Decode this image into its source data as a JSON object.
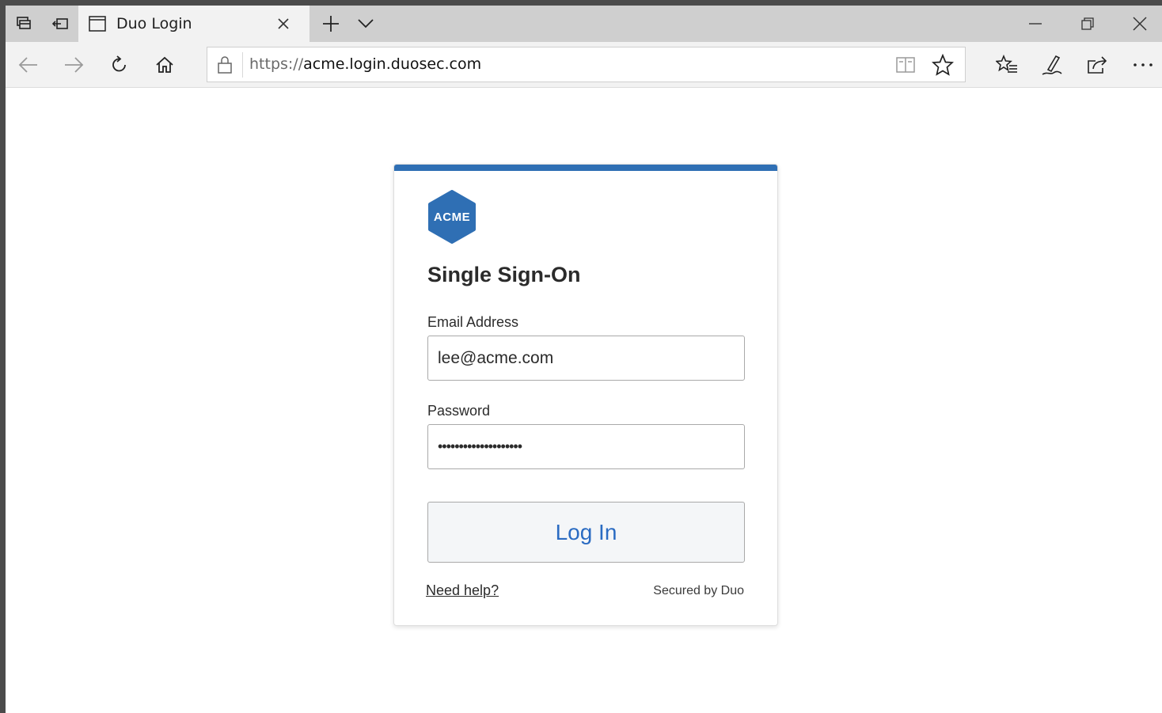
{
  "browser": {
    "tab": {
      "title": "Duo Login"
    },
    "address": {
      "scheme": "https://",
      "host": "acme.login.duosec.com"
    }
  },
  "login": {
    "logo_text": "ACME",
    "heading": "Single Sign-On",
    "email_label": "Email Address",
    "email_value": "lee@acme.com",
    "password_label": "Password",
    "password_value": "••••••••••••••••••••",
    "login_button": "Log In",
    "help_link": "Need help?",
    "secured_text": "Secured by Duo"
  },
  "colors": {
    "accent": "#2f6fb4",
    "button_text": "#2a6bc2"
  },
  "icons": [
    "tab-actions-icon",
    "set-aside-tabs-icon",
    "page-icon",
    "close-icon",
    "plus-icon",
    "chevron-down-icon",
    "minimize-icon",
    "restore-icon",
    "back-arrow-icon",
    "forward-arrow-icon",
    "refresh-icon",
    "home-icon",
    "lock-icon",
    "reading-view-icon",
    "star-icon",
    "favorites-icon",
    "pen-icon",
    "share-icon",
    "more-icon"
  ]
}
